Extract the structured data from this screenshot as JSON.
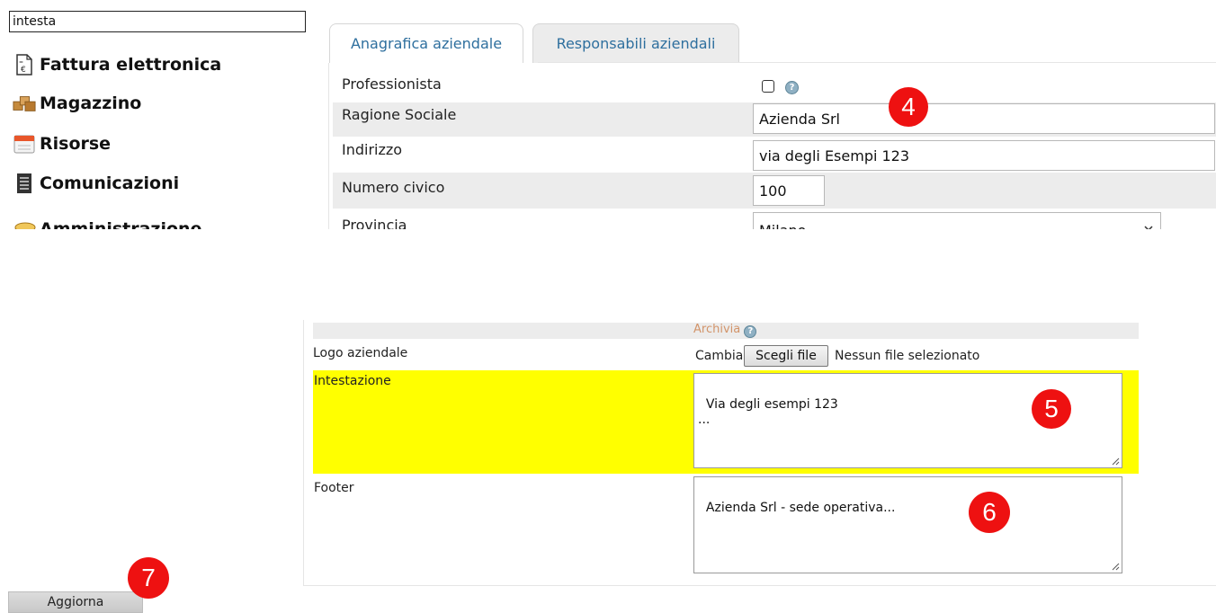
{
  "sidebar": {
    "search_value": "intesta",
    "items": [
      {
        "label": "Fattura elettronica",
        "icon": "invoice-euro-icon"
      },
      {
        "label": "Magazzino",
        "icon": "boxes-icon"
      },
      {
        "label": "Risorse",
        "icon": "calendar-icon"
      },
      {
        "label": "Comunicazioni",
        "icon": "document-icon"
      },
      {
        "label": "Amministrazione",
        "icon": "coins-icon"
      }
    ]
  },
  "tabs": [
    {
      "label": "Anagrafica aziendale",
      "active": true
    },
    {
      "label": "Responsabili aziendali",
      "active": false
    }
  ],
  "form": {
    "professionista_label": "Professionista",
    "ragione_sociale_label": "Ragione Sociale",
    "ragione_sociale_value": "Azienda Srl",
    "indirizzo_label": "Indirizzo",
    "indirizzo_value": "via degli Esempi 123",
    "numero_civico_label": "Numero civico",
    "numero_civico_value": "100",
    "provincia_label": "Provincia",
    "provincia_value": "Milano"
  },
  "bottom": {
    "archivia_label": "Archivia",
    "logo_label": "Logo aziendale",
    "cambia_label": "Cambia",
    "choose_file_label": "Scegli file",
    "no_file_label": "Nessun file selezionato",
    "intestazione_label": "Intestazione",
    "intestazione_value": "Via degli esempi 123\n...",
    "footer_label": "Footer",
    "footer_value": "Azienda Srl - sede operativa..."
  },
  "update_label": "Aggiorna",
  "help_glyph": "?",
  "badges": [
    "4",
    "5",
    "6",
    "7"
  ],
  "colors": {
    "badge": "#ee1111",
    "highlight": "#ffff00",
    "tab_text": "#2e6f9e",
    "row_shade": "#ececec",
    "archivia_text": "#d2946a"
  }
}
